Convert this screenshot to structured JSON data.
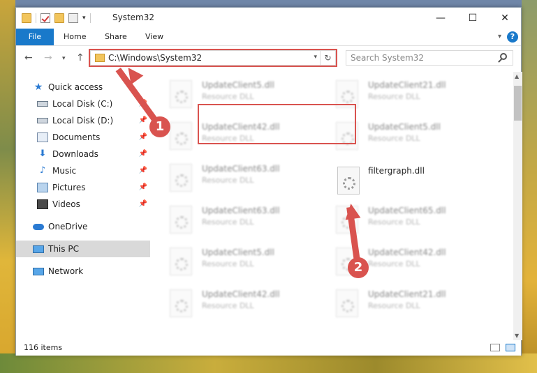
{
  "window": {
    "title": "System32",
    "controls": {
      "minimize": "—",
      "maximize": "☐",
      "close": "✕"
    }
  },
  "ribbon": {
    "tabs": [
      "File",
      "Home",
      "Share",
      "View"
    ],
    "help": "?"
  },
  "address": {
    "path": "C:\\Windows\\System32",
    "search_placeholder": "Search System32"
  },
  "nav": {
    "quick_access": "Quick access",
    "items": [
      {
        "label": "Local Disk (C:)",
        "icon": "drive-icon",
        "pinned": true
      },
      {
        "label": "Local Disk (D:)",
        "icon": "drive-icon",
        "pinned": true
      },
      {
        "label": "Documents",
        "icon": "documents-icon",
        "pinned": true
      },
      {
        "label": "Downloads",
        "icon": "downloads-icon",
        "pinned": true
      },
      {
        "label": "Music",
        "icon": "music-icon",
        "pinned": true
      },
      {
        "label": "Pictures",
        "icon": "pictures-icon",
        "pinned": true
      },
      {
        "label": "Videos",
        "icon": "videos-icon",
        "pinned": true
      }
    ],
    "onedrive": "OneDrive",
    "this_pc": "This PC",
    "network": "Network"
  },
  "files": [
    {
      "name": "UpdateClient5.dll",
      "type": "Resource DLL"
    },
    {
      "name": "UpdateClient21.dll",
      "type": "Resource DLL"
    },
    {
      "name": "UpdateClient42.dll",
      "type": "Resource DLL"
    },
    {
      "name": "UpdateClient5.dll",
      "type": "Resource DLL"
    },
    {
      "name": "UpdateClient63.dll",
      "type": "Resource DLL"
    },
    {
      "name": "filtergraph.dll",
      "type": ""
    },
    {
      "name": "UpdateClient63.dll",
      "type": "Resource DLL"
    },
    {
      "name": "UpdateClient65.dll",
      "type": "Resource DLL"
    },
    {
      "name": "UpdateClient5.dll",
      "type": "Resource DLL"
    },
    {
      "name": "UpdateClient42.dll",
      "type": "Resource DLL"
    },
    {
      "name": "UpdateClient42.dll",
      "type": "Resource DLL"
    },
    {
      "name": "UpdateClient21.dll",
      "type": "Resource DLL"
    }
  ],
  "status": {
    "item_count": "116 items"
  },
  "annotations": {
    "step1": "1",
    "step2": "2"
  },
  "colors": {
    "accent": "#1979ca",
    "highlight": "#d9534f"
  }
}
